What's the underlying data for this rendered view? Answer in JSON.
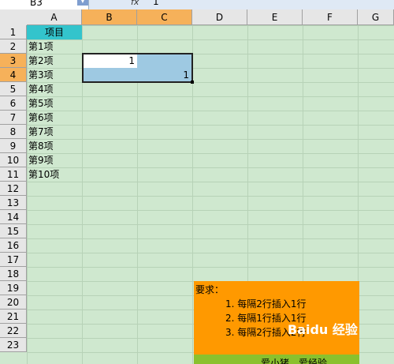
{
  "formula_bar": {
    "cell_ref": "B3",
    "fx": "fx",
    "value": "1"
  },
  "columns": [
    "A",
    "B",
    "C",
    "D",
    "E",
    "F",
    "G"
  ],
  "rows": [
    "1",
    "2",
    "3",
    "4",
    "5",
    "6",
    "7",
    "8",
    "9",
    "10",
    "11",
    "12",
    "13",
    "14",
    "15",
    "16",
    "17",
    "18",
    "19",
    "20",
    "21",
    "22",
    "23"
  ],
  "cells": {
    "A1": "项目",
    "A2": "第1项",
    "A3": "第2项",
    "A4": "第3项",
    "A5": "第4项",
    "A6": "第5项",
    "A7": "第6项",
    "A8": "第7项",
    "A9": "第8项",
    "A10": "第9项",
    "A11": "第10项",
    "B3": "1",
    "C4": "1"
  },
  "note": {
    "title": "要求：",
    "items": [
      "1. 每隔2行插入1行",
      "2. 每隔1行插入1行",
      "3. 每隔2行插入2行"
    ],
    "footer": "爱小猪，爱经验"
  },
  "watermark": "Baidu 经验",
  "colors": {
    "grid_background": "#cfe8cf",
    "header_a1": "#33c4cc",
    "selected_header": "#f6b15a",
    "note_background": "#ff9900",
    "footer_background": "#8ac12e"
  }
}
